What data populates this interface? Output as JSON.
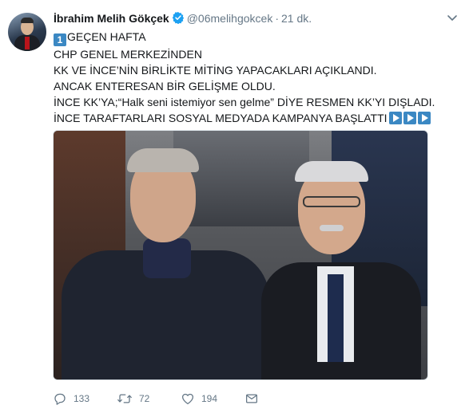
{
  "tweet": {
    "author_name": "İbrahim Melih Gökçek",
    "handle": "@06melihgokcek",
    "separator": "·",
    "time": "21 dk.",
    "lines": [
      {
        "prefix_icon": "1",
        "text": "GEÇEN HAFTA"
      },
      {
        "text": "CHP GENEL MERKEZİNDEN"
      },
      {
        "text": "KK VE İNCE’NİN BİRLİKTE MİTİNG YAPACAKLARI AÇIKLANDI."
      },
      {
        "text": "ANCAK ENTERESAN BİR GELİŞME OLDU."
      },
      {
        "text": "İNCE KK’YA;“Halk seni istemiyor sen gelme” DİYE RESMEN KK’YI DIŞLADI."
      },
      {
        "text": "İNCE TARAFTARLARI SOSYAL MEDYADA KAMPANYA BAŞLATTI"
      }
    ],
    "trailing_icons": [
      "play-button-icon",
      "play-button-icon",
      "play-button-icon"
    ]
  },
  "actions": {
    "reply_count": "133",
    "retweet_count": "72",
    "like_count": "194"
  },
  "colors": {
    "accent": "#1da1f2",
    "muted": "#657786",
    "keycap": "#3b88c3"
  }
}
